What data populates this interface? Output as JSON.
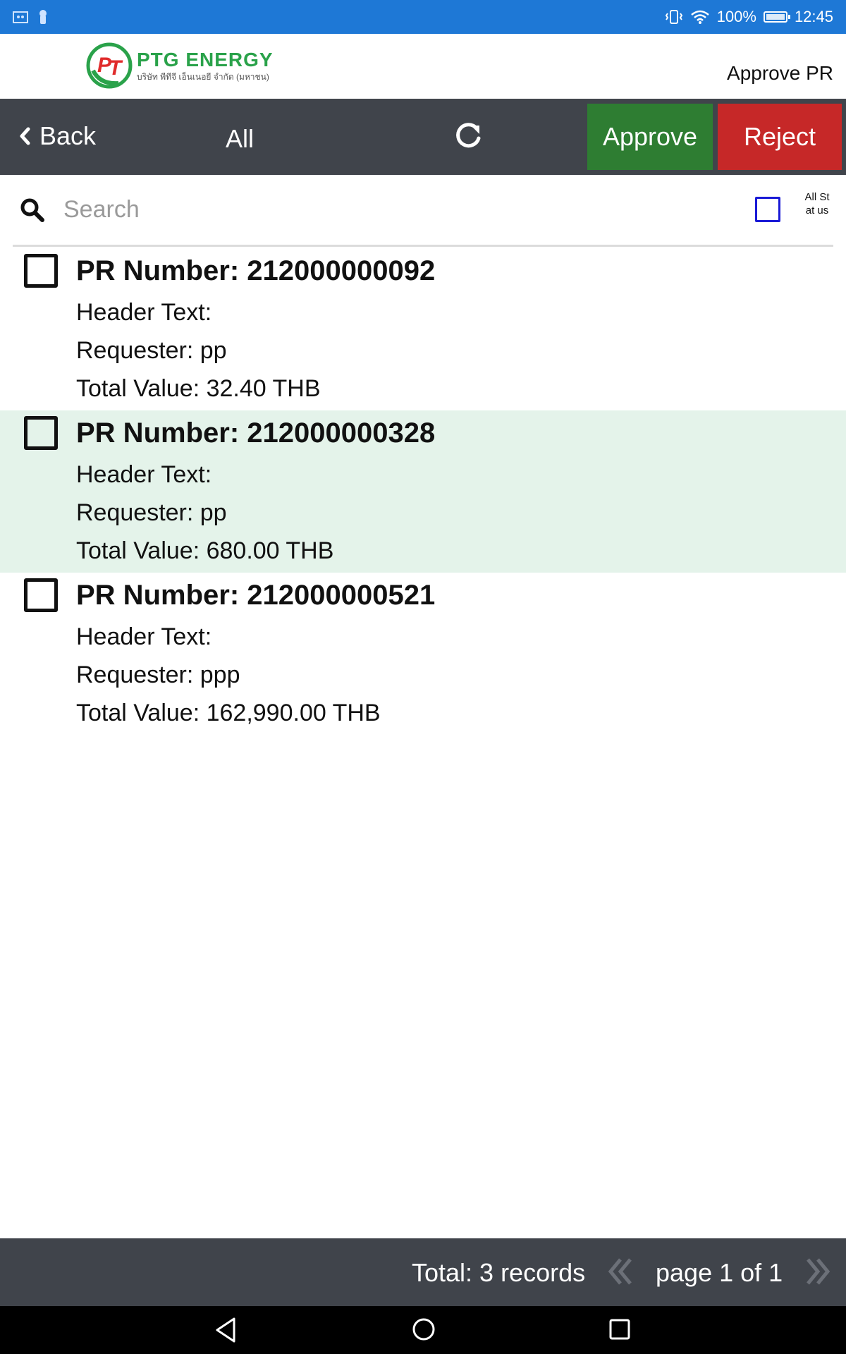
{
  "status_bar": {
    "battery_percent": "100%",
    "time": "12:45",
    "background_color": "#1e78d6"
  },
  "header": {
    "logo_brand": "PTG ENERGY",
    "logo_subtitle": "บริษัท พีทีจี เอ็นเนอยี จำกัด (มหาชน)",
    "page_title": "Approve PR"
  },
  "toolbar": {
    "back_label": "Back",
    "filter_label": "All",
    "approve_label": "Approve",
    "reject_label": "Reject",
    "approve_color": "#2e7d32",
    "reject_color": "#c62828",
    "background_color": "#40444b"
  },
  "search": {
    "placeholder": "Search",
    "value": "",
    "all_status_label": "All Stat us"
  },
  "pr_items": [
    {
      "number": "PR Number: 212000000092",
      "header_text": "Header Text:",
      "requester": "Requester: pp",
      "total_value": "Total Value: 32.40 THB",
      "highlighted": false,
      "checked": false
    },
    {
      "number": "PR Number: 212000000328",
      "header_text": "Header Text:",
      "requester": "Requester: pp",
      "total_value": "Total Value: 680.00 THB",
      "highlighted": true,
      "checked": false
    },
    {
      "number": "PR Number: 212000000521",
      "header_text": "Header Text:",
      "requester": "Requester: ppp",
      "total_value": "Total Value: 162,990.00 THB",
      "highlighted": false,
      "checked": false
    }
  ],
  "footer": {
    "total_text": "Total: 3 records",
    "page_text": "page 1 of 1"
  },
  "icons": {
    "back": "chevron-left-icon",
    "refresh": "refresh-icon",
    "search": "search-icon",
    "prev_page": "double-chevron-left-icon",
    "next_page": "double-chevron-right-icon"
  }
}
